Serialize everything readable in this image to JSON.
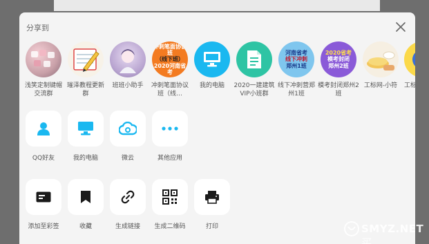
{
  "dialog": {
    "title": "分享到"
  },
  "contacts": [
    {
      "label": "浅笑定制键帽交流群"
    },
    {
      "label": "璀泽教程更新群"
    },
    {
      "label": "班班小助手"
    },
    {
      "label": "冲刺笔面协议班（线…",
      "avatar_lines": [
        "冲刺笔面协议班",
        "（线下班）",
        "2020河南省考"
      ]
    },
    {
      "label": "我的电脑"
    },
    {
      "label": "2020一建建筑VIP小班群"
    },
    {
      "label": "线下冲刺营郑州1班",
      "avatar_lines": [
        "河南省考",
        "线下冲刺",
        "郑州1班"
      ]
    },
    {
      "label": "模考封闭郑州2班",
      "avatar_lines": [
        "2020省考",
        "模考封闭",
        "郑州2班"
      ]
    },
    {
      "label": "工标网-小符"
    },
    {
      "label": "工标"
    }
  ],
  "row_apps": [
    {
      "label": "QQ好友",
      "icon": "qq-friend-icon"
    },
    {
      "label": "我的电脑",
      "icon": "computer-icon"
    },
    {
      "label": "微云",
      "icon": "cloud-icon"
    },
    {
      "label": "其他应用",
      "icon": "more-icon"
    }
  ],
  "row_tools": [
    {
      "label": "添加至彩签",
      "icon": "sticky-note-icon"
    },
    {
      "label": "收藏",
      "icon": "bookmark-icon"
    },
    {
      "label": "生成链接",
      "icon": "link-icon"
    },
    {
      "label": "生成二维码",
      "icon": "qr-code-icon"
    },
    {
      "label": "打印",
      "icon": "printer-icon"
    }
  ],
  "watermark": {
    "text": "SMYZ.NET",
    "suffix": "买"
  },
  "colors": {
    "accent_blue": "#1ab8f0",
    "accent_teal": "#2ec4a4",
    "icon_dark": "#1a1a1a"
  }
}
